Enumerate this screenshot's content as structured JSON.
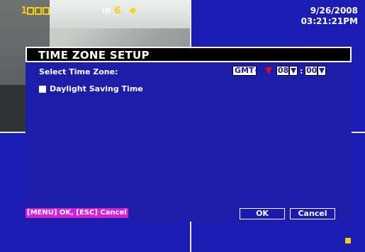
{
  "status": {
    "camera_number": "1",
    "ir_label": "IR",
    "ir_value": "6"
  },
  "clock": {
    "date": "9/26/2008",
    "time": "03:21:21PM"
  },
  "dialog": {
    "title": "TIME ZONE SETUP",
    "select_tz_label": "Select Time Zone:",
    "gmt_value": "GMT+",
    "hour_value": "08",
    "minute_separator": ":",
    "minute_value": "00",
    "dst_label": "Daylight Saving Time",
    "dst_checked": false,
    "hint": "[MENU] OK, [ESC] Cancel",
    "ok_label": "OK",
    "cancel_label": "Cancel"
  },
  "colors": {
    "background_blue": "#1a1fb0",
    "title_bar": "#000000",
    "hint_bg": "#d61fd6",
    "status_yellow": "#ffd000",
    "gmt_arrow_red": "#e01010"
  }
}
